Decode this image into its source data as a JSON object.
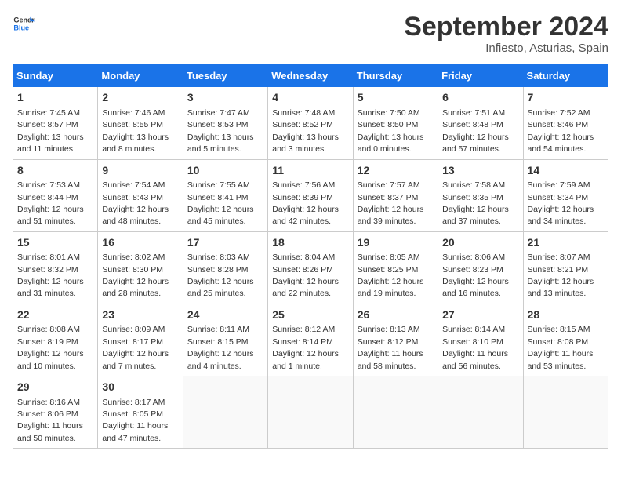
{
  "header": {
    "logo_line1": "General",
    "logo_line2": "Blue",
    "month": "September 2024",
    "location": "Infiesto, Asturias, Spain"
  },
  "days_of_week": [
    "Sunday",
    "Monday",
    "Tuesday",
    "Wednesday",
    "Thursday",
    "Friday",
    "Saturday"
  ],
  "weeks": [
    [
      {
        "day": "1",
        "sunrise": "7:45 AM",
        "sunset": "8:57 PM",
        "daylight": "13 hours and 11 minutes."
      },
      {
        "day": "2",
        "sunrise": "7:46 AM",
        "sunset": "8:55 PM",
        "daylight": "13 hours and 8 minutes."
      },
      {
        "day": "3",
        "sunrise": "7:47 AM",
        "sunset": "8:53 PM",
        "daylight": "13 hours and 5 minutes."
      },
      {
        "day": "4",
        "sunrise": "7:48 AM",
        "sunset": "8:52 PM",
        "daylight": "13 hours and 3 minutes."
      },
      {
        "day": "5",
        "sunrise": "7:50 AM",
        "sunset": "8:50 PM",
        "daylight": "13 hours and 0 minutes."
      },
      {
        "day": "6",
        "sunrise": "7:51 AM",
        "sunset": "8:48 PM",
        "daylight": "12 hours and 57 minutes."
      },
      {
        "day": "7",
        "sunrise": "7:52 AM",
        "sunset": "8:46 PM",
        "daylight": "12 hours and 54 minutes."
      }
    ],
    [
      {
        "day": "8",
        "sunrise": "7:53 AM",
        "sunset": "8:44 PM",
        "daylight": "12 hours and 51 minutes."
      },
      {
        "day": "9",
        "sunrise": "7:54 AM",
        "sunset": "8:43 PM",
        "daylight": "12 hours and 48 minutes."
      },
      {
        "day": "10",
        "sunrise": "7:55 AM",
        "sunset": "8:41 PM",
        "daylight": "12 hours and 45 minutes."
      },
      {
        "day": "11",
        "sunrise": "7:56 AM",
        "sunset": "8:39 PM",
        "daylight": "12 hours and 42 minutes."
      },
      {
        "day": "12",
        "sunrise": "7:57 AM",
        "sunset": "8:37 PM",
        "daylight": "12 hours and 39 minutes."
      },
      {
        "day": "13",
        "sunrise": "7:58 AM",
        "sunset": "8:35 PM",
        "daylight": "12 hours and 37 minutes."
      },
      {
        "day": "14",
        "sunrise": "7:59 AM",
        "sunset": "8:34 PM",
        "daylight": "12 hours and 34 minutes."
      }
    ],
    [
      {
        "day": "15",
        "sunrise": "8:01 AM",
        "sunset": "8:32 PM",
        "daylight": "12 hours and 31 minutes."
      },
      {
        "day": "16",
        "sunrise": "8:02 AM",
        "sunset": "8:30 PM",
        "daylight": "12 hours and 28 minutes."
      },
      {
        "day": "17",
        "sunrise": "8:03 AM",
        "sunset": "8:28 PM",
        "daylight": "12 hours and 25 minutes."
      },
      {
        "day": "18",
        "sunrise": "8:04 AM",
        "sunset": "8:26 PM",
        "daylight": "12 hours and 22 minutes."
      },
      {
        "day": "19",
        "sunrise": "8:05 AM",
        "sunset": "8:25 PM",
        "daylight": "12 hours and 19 minutes."
      },
      {
        "day": "20",
        "sunrise": "8:06 AM",
        "sunset": "8:23 PM",
        "daylight": "12 hours and 16 minutes."
      },
      {
        "day": "21",
        "sunrise": "8:07 AM",
        "sunset": "8:21 PM",
        "daylight": "12 hours and 13 minutes."
      }
    ],
    [
      {
        "day": "22",
        "sunrise": "8:08 AM",
        "sunset": "8:19 PM",
        "daylight": "12 hours and 10 minutes."
      },
      {
        "day": "23",
        "sunrise": "8:09 AM",
        "sunset": "8:17 PM",
        "daylight": "12 hours and 7 minutes."
      },
      {
        "day": "24",
        "sunrise": "8:11 AM",
        "sunset": "8:15 PM",
        "daylight": "12 hours and 4 minutes."
      },
      {
        "day": "25",
        "sunrise": "8:12 AM",
        "sunset": "8:14 PM",
        "daylight": "12 hours and 1 minute."
      },
      {
        "day": "26",
        "sunrise": "8:13 AM",
        "sunset": "8:12 PM",
        "daylight": "11 hours and 58 minutes."
      },
      {
        "day": "27",
        "sunrise": "8:14 AM",
        "sunset": "8:10 PM",
        "daylight": "11 hours and 56 minutes."
      },
      {
        "day": "28",
        "sunrise": "8:15 AM",
        "sunset": "8:08 PM",
        "daylight": "11 hours and 53 minutes."
      }
    ],
    [
      {
        "day": "29",
        "sunrise": "8:16 AM",
        "sunset": "8:06 PM",
        "daylight": "11 hours and 50 minutes."
      },
      {
        "day": "30",
        "sunrise": "8:17 AM",
        "sunset": "8:05 PM",
        "daylight": "11 hours and 47 minutes."
      },
      null,
      null,
      null,
      null,
      null
    ]
  ]
}
